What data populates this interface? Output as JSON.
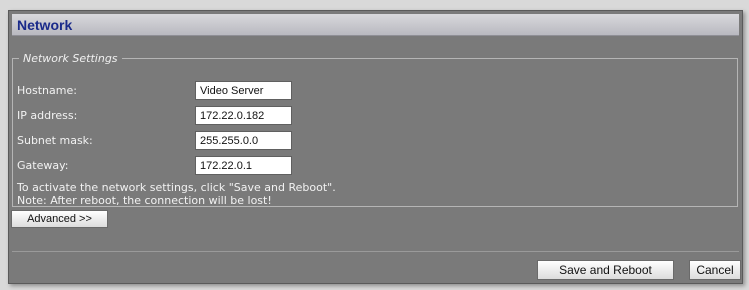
{
  "window": {
    "title": "Network"
  },
  "network_settings": {
    "legend": "Network Settings",
    "fields": [
      {
        "label": "Hostname:",
        "value": "Video Server"
      },
      {
        "label": "IP address:",
        "value": "172.22.0.182"
      },
      {
        "label": "Subnet mask:",
        "value": "255.255.0.0"
      },
      {
        "label": "Gateway:",
        "value": "172.22.0.1"
      }
    ],
    "note_line1": "To activate the network settings, click \"Save and Reboot\".",
    "note_line2": "Note: After reboot, the connection will be lost!"
  },
  "buttons": {
    "advanced": "Advanced >>",
    "save_reboot": "Save and Reboot",
    "cancel": "Cancel"
  }
}
